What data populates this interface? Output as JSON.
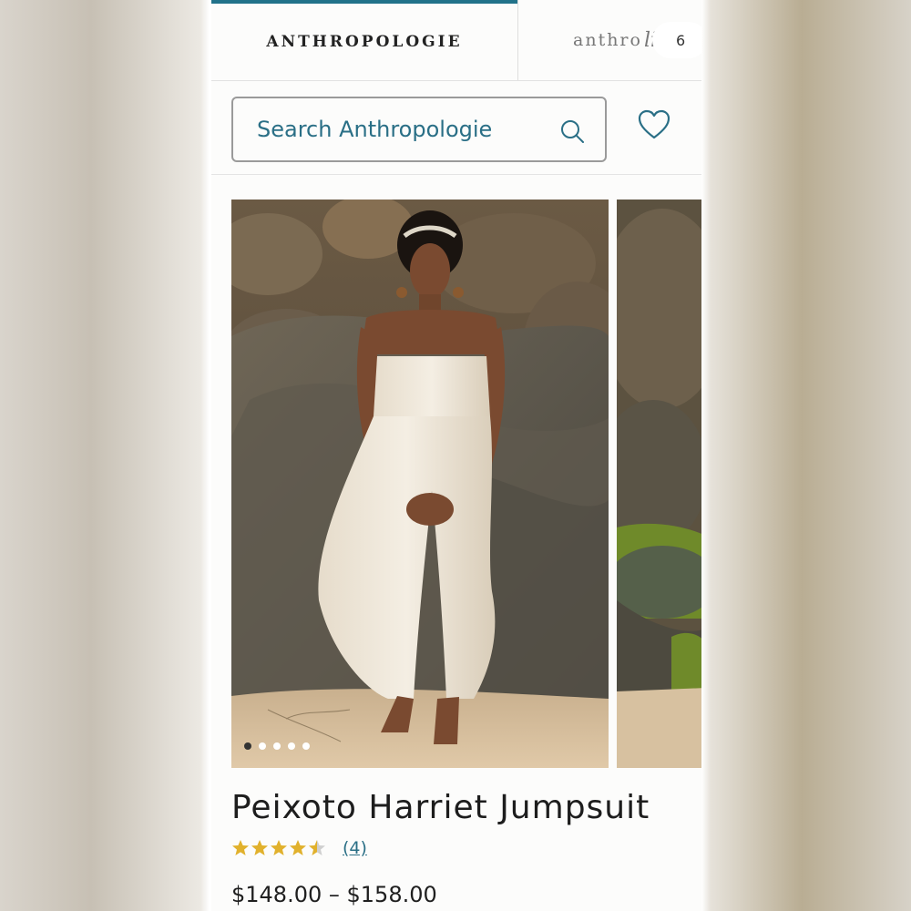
{
  "brand_tabs": {
    "active_label": "ANTHROPOLOGIE",
    "second_prefix": "anthro",
    "second_script": "living"
  },
  "search": {
    "placeholder": "Search Anthropologie",
    "icon": "search-icon"
  },
  "wishlist": {
    "icon": "heart-icon"
  },
  "carousel": {
    "dot_count": 5,
    "active_dot": 1,
    "next_badge_partial": "6"
  },
  "product": {
    "title": "Peixoto Harriet Jumpsuit",
    "rating": 4.5,
    "rating_max": 5,
    "review_count_label": "(4)",
    "price": "$148.00 – $158.00"
  },
  "colors": {
    "accent": "#21728a",
    "link": "#2a6f86",
    "star": "#e1b12c"
  }
}
